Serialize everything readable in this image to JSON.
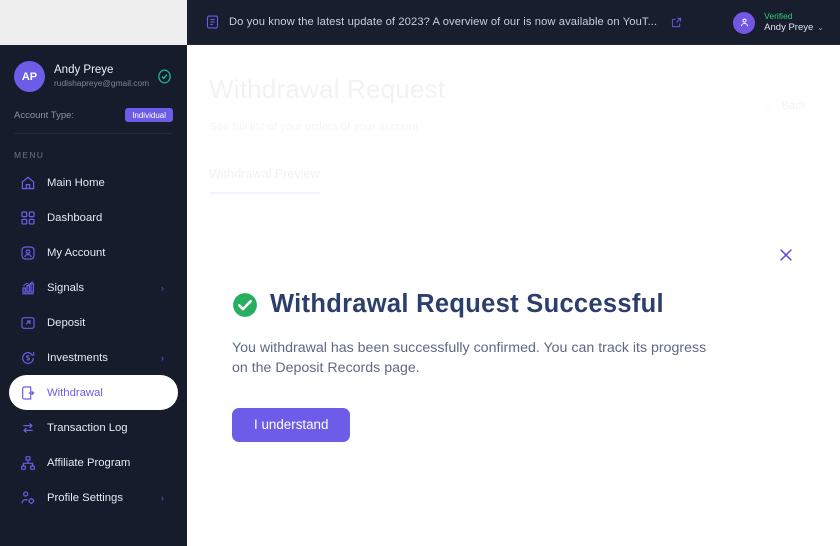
{
  "topbar": {
    "notice_icon": "document-icon",
    "notice_text": "Do you know the latest update of 2023? A overview of our is now available on YouT...",
    "external_link_icon": "external-link-icon",
    "verified_label": "Verified",
    "user_name": "Andy Preye",
    "caret": "⌄"
  },
  "sidebar": {
    "avatar_initials": "AP",
    "profile_name": "Andy Preye",
    "profile_email": "rudishapreye@gmail.com",
    "verified_icon": "verified-check-icon",
    "account_type_label": "Account Type:",
    "account_type_value": "Individual",
    "menu_label": "MENU",
    "items": [
      {
        "label": "Main Home",
        "icon": "home-icon",
        "chevron": "",
        "active": false
      },
      {
        "label": "Dashboard",
        "icon": "grid-icon",
        "chevron": "",
        "active": false
      },
      {
        "label": "My Account",
        "icon": "user-square-icon",
        "chevron": "",
        "active": false
      },
      {
        "label": "Signals",
        "icon": "bar-chart-icon",
        "chevron": "›",
        "active": false
      },
      {
        "label": "Deposit",
        "icon": "deposit-icon",
        "chevron": "",
        "active": false
      },
      {
        "label": "Investments",
        "icon": "refresh-coin-icon",
        "chevron": "›",
        "active": false
      },
      {
        "label": "Withdrawal",
        "icon": "withdrawal-icon",
        "chevron": "",
        "active": true
      },
      {
        "label": "Transaction Log",
        "icon": "swap-arrows-icon",
        "chevron": "",
        "active": false
      },
      {
        "label": "Affiliate Program",
        "icon": "sitemap-icon",
        "chevron": "",
        "active": false
      },
      {
        "label": "Profile Settings",
        "icon": "person-gear-icon",
        "chevron": "›",
        "active": false
      }
    ]
  },
  "main": {
    "title": "Withdrawal Request",
    "subtitle": "See full list of your orders of your account",
    "back_label": "Back",
    "back_arrow": "←",
    "tabs": [
      {
        "label": "Withdrawal Preview",
        "active": true
      }
    ]
  },
  "modal": {
    "close_icon": "close-icon",
    "status_icon": "success-check-icon",
    "title": "Withdrawal Request Successful",
    "message": "You withdrawal has been successfully confirmed. You can track its progress on the Deposit Records page.",
    "primary_button": "I understand"
  },
  "colors": {
    "accent_purple": "#6c5ce7",
    "sidebar_bg": "#161c2b",
    "topbar_bg": "#181e2e",
    "success_green": "#2ecc71",
    "title_navy": "#2c3e6b"
  }
}
